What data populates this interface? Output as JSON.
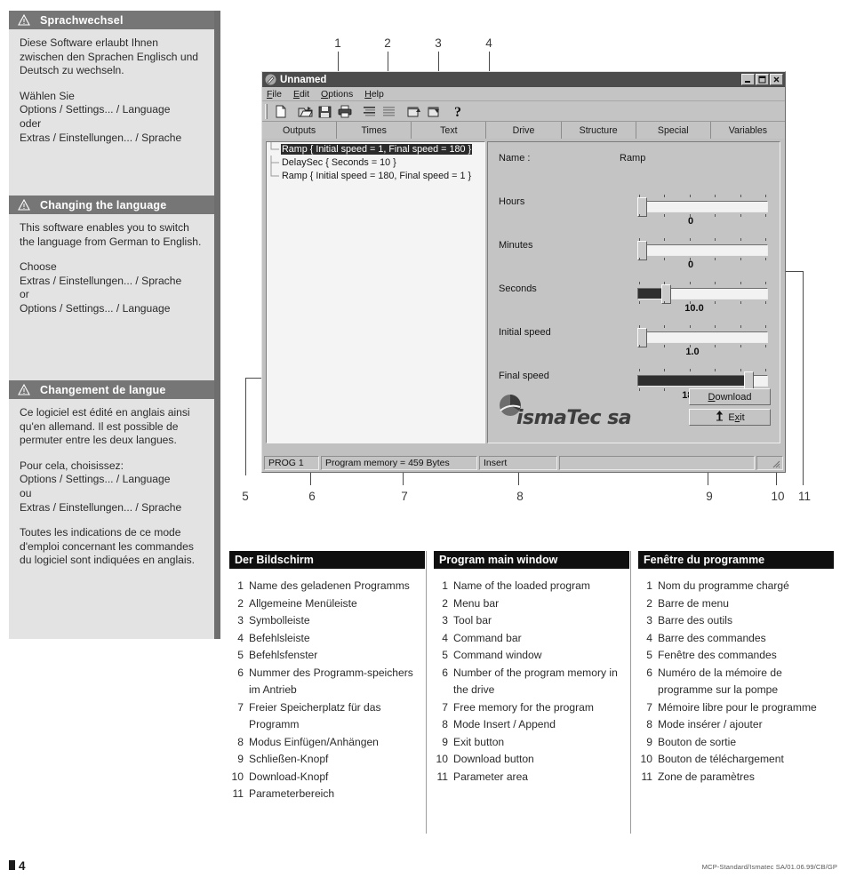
{
  "sidebar": {
    "sections": [
      {
        "icon": "warning-triangle-icon",
        "title": "Sprachwechsel",
        "paragraphs": [
          "Diese Software erlaubt Ihnen zwischen den Sprachen Englisch und Deutsch zu wechseln.",
          "Wählen Sie\nOptions / Settings... / Language\noder\nExtras / Einstellungen... / Sprache"
        ]
      },
      {
        "icon": "warning-triangle-icon",
        "title": "Changing the language",
        "paragraphs": [
          "This software enables you to switch the language from German to English.",
          "Choose\nExtras / Einstellungen... / Sprache\nor\nOptions / Settings... / Language"
        ]
      },
      {
        "icon": "warning-triangle-icon",
        "title": "Changement de langue",
        "paragraphs": [
          "Ce logiciel est édité en anglais ainsi qu'en allemand. Il est possible de permuter entre les deux langues.",
          "Pour cela, choisissez:\nOptions / Settings... / Language\nou\nExtras / Einstellungen... / Sprache",
          "Toutes les indications de ce mode d'emploi concernant les commandes du logiciel sont indiquées en anglais."
        ]
      }
    ]
  },
  "callouts": {
    "top": [
      "1",
      "2",
      "3",
      "4"
    ],
    "bottom": [
      "5",
      "6",
      "7",
      "8",
      "9",
      "10",
      "11"
    ]
  },
  "app": {
    "title": "Unnamed",
    "title_icon": "pencil-document-icon",
    "window_buttons": [
      {
        "name": "minimize-button",
        "glyph": "_"
      },
      {
        "name": "maximize-button",
        "glyph": "❐"
      },
      {
        "name": "close-button",
        "glyph": "✕"
      }
    ],
    "menu": [
      {
        "label": "File",
        "mnemonic": "F"
      },
      {
        "label": "Edit",
        "mnemonic": "E"
      },
      {
        "label": "Options",
        "mnemonic": "O"
      },
      {
        "label": "Help",
        "mnemonic": "H"
      }
    ],
    "toolbar": [
      {
        "name": "new-document-icon",
        "title": "New"
      },
      {
        "name": "open-folder-icon",
        "title": "Open"
      },
      {
        "name": "save-floppy-icon",
        "title": "Save"
      },
      {
        "name": "print-icon",
        "title": "Print"
      },
      {
        "name": "insert-line-icon",
        "title": "Insert"
      },
      {
        "name": "append-line-icon",
        "title": "Append"
      },
      {
        "name": "upload-window-icon",
        "title": "Upload"
      },
      {
        "name": "download-window-icon",
        "title": "Download"
      },
      {
        "name": "help-question-icon",
        "title": "Help"
      }
    ],
    "command_bar_tabs": [
      "Outputs",
      "Times",
      "Text",
      "Drive",
      "Structure",
      "Special",
      "Variables"
    ],
    "command_window": {
      "rows": [
        {
          "text": "Ramp { Initial speed = 1, Final speed = 180 }",
          "selected": true
        },
        {
          "text": "DelaySec { Seconds = 10 }",
          "selected": false
        },
        {
          "text": "Ramp { Initial speed = 180, Final speed = 1 }",
          "selected": false
        }
      ]
    },
    "parameters": {
      "name_label": "Name :",
      "name_value": "Ramp",
      "sliders": [
        {
          "label": "Hours",
          "value": "0",
          "fill_pct": 0,
          "thumb_pct": 0
        },
        {
          "label": "Minutes",
          "value": "0",
          "fill_pct": 0,
          "thumb_pct": 0
        },
        {
          "label": "Seconds",
          "value": "10.0",
          "fill_pct": 28,
          "thumb_pct": 28
        },
        {
          "label": "Initial speed",
          "value": "1.0",
          "fill_pct": 0,
          "thumb_pct": 0
        },
        {
          "label": "Final speed",
          "value": "180.0",
          "fill_pct": 86,
          "thumb_pct": 86
        }
      ]
    },
    "logo": {
      "icon": "ismatec-sphere-icon",
      "text": "ismaTec sa"
    },
    "buttons": [
      {
        "name": "download-button",
        "label": "Download",
        "mnemonic": "D",
        "icon": ""
      },
      {
        "name": "exit-button",
        "label": "Exit",
        "mnemonic": "x",
        "icon": "exit-door-icon"
      }
    ],
    "statusbar": {
      "program": "PROG 1",
      "memory": "Program memory = 459 Bytes",
      "mode": "Insert",
      "blank": "",
      "resize_grip": "resize-grip-icon"
    }
  },
  "legends": [
    {
      "title": "Der Bildschirm",
      "items": [
        {
          "n": "1",
          "t": "Name des geladenen Programms"
        },
        {
          "n": "2",
          "t": "Allgemeine Menüleiste"
        },
        {
          "n": "3",
          "t": "Symbolleiste"
        },
        {
          "n": "4",
          "t": "Befehlsleiste"
        },
        {
          "n": "5",
          "t": "Befehlsfenster"
        },
        {
          "n": "6",
          "t": "Nummer des Programm-speichers im Antrieb"
        },
        {
          "n": "7",
          "t": "Freier Speicherplatz für das Programm"
        },
        {
          "n": "8",
          "t": "Modus Einfügen/Anhängen"
        },
        {
          "n": "9",
          "t": "Schließen-Knopf"
        },
        {
          "n": "10",
          "t": "Download-Knopf"
        },
        {
          "n": "11",
          "t": "Parameterbereich"
        }
      ]
    },
    {
      "title": "Program main window",
      "items": [
        {
          "n": "1",
          "t": "Name of the loaded program"
        },
        {
          "n": "2",
          "t": "Menu bar"
        },
        {
          "n": "3",
          "t": "Tool bar"
        },
        {
          "n": "4",
          "t": "Command bar"
        },
        {
          "n": "5",
          "t": "Command window"
        },
        {
          "n": "6",
          "t": "Number of the program memory in the drive"
        },
        {
          "n": "7",
          "t": "Free memory for the program"
        },
        {
          "n": "8",
          "t": "Mode Insert / Append"
        },
        {
          "n": "9",
          "t": "Exit button"
        },
        {
          "n": "10",
          "t": "Download button"
        },
        {
          "n": "11",
          "t": "Parameter area"
        }
      ]
    },
    {
      "title": "Fenêtre du programme",
      "items": [
        {
          "n": "1",
          "t": "Nom du programme chargé"
        },
        {
          "n": "2",
          "t": "Barre de menu"
        },
        {
          "n": "3",
          "t": "Barre des outils"
        },
        {
          "n": "4",
          "t": "Barre des commandes"
        },
        {
          "n": "5",
          "t": "Fenêtre des commandes"
        },
        {
          "n": "6",
          "t": "Numéro de la mémoire de programme sur la pompe"
        },
        {
          "n": "7",
          "t": "Mémoire libre pour le programme"
        },
        {
          "n": "8",
          "t": "Mode insérer / ajouter"
        },
        {
          "n": "9",
          "t": "Bouton de sortie"
        },
        {
          "n": "10",
          "t": "Bouton de téléchargement"
        },
        {
          "n": "11",
          "t": "Zone de paramètres"
        }
      ]
    }
  ],
  "footer": {
    "page": "4",
    "reference": "MCP-Standard/Ismatec SA/01.06.99/CB/GP"
  },
  "colors": {
    "sidebar_bg": "#e3e3e3",
    "panel_head_bg": "#767676",
    "legend_head_bg": "#0f0f0f",
    "window_face": "#c0c0c0",
    "titlebar_bg": "#4c4c4c",
    "selection_bg": "#2b2b2b"
  }
}
